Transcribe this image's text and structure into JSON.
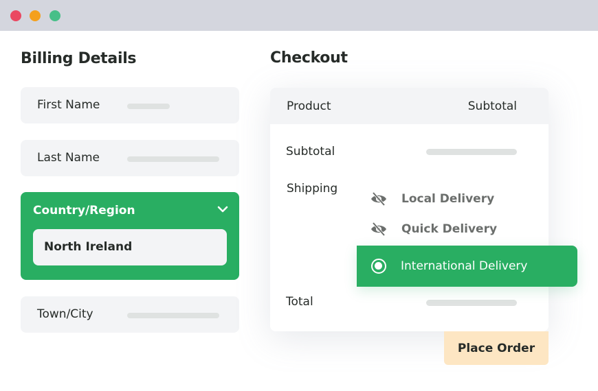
{
  "window": {
    "controls": [
      "close",
      "minimize",
      "maximize"
    ]
  },
  "billing": {
    "title": "Billing Details",
    "fields": [
      {
        "label": "First Name",
        "value_state": "placeholder-bar"
      },
      {
        "label": "Last Name",
        "value_state": "placeholder-bar"
      },
      {
        "label": "Country/Region",
        "value": "North Ireland",
        "state": "expanded"
      },
      {
        "label": "Town/City",
        "value_state": "placeholder-bar"
      }
    ],
    "country_icon": "chevron-down-icon"
  },
  "checkout": {
    "title": "Checkout",
    "header": {
      "product": "Product",
      "subtotal": "Subtotal"
    },
    "rows": {
      "subtotal": "Subtotal",
      "shipping": "Shipping",
      "total": "Total"
    },
    "shipping_options": [
      {
        "label": "Local Delivery",
        "icon": "eye-off-icon",
        "selected": false
      },
      {
        "label": "Quick Delivery",
        "icon": "eye-off-icon",
        "selected": false
      },
      {
        "label": "International Delivery",
        "icon": "radio-selected-icon",
        "selected": true
      }
    ],
    "place_order": "Place Order"
  },
  "colors": {
    "accent_green": "#29ae62",
    "field_bg": "#f3f4f6",
    "button_bg": "#fde6c3",
    "text": "#262b28",
    "muted_text": "#6b6e6c"
  }
}
